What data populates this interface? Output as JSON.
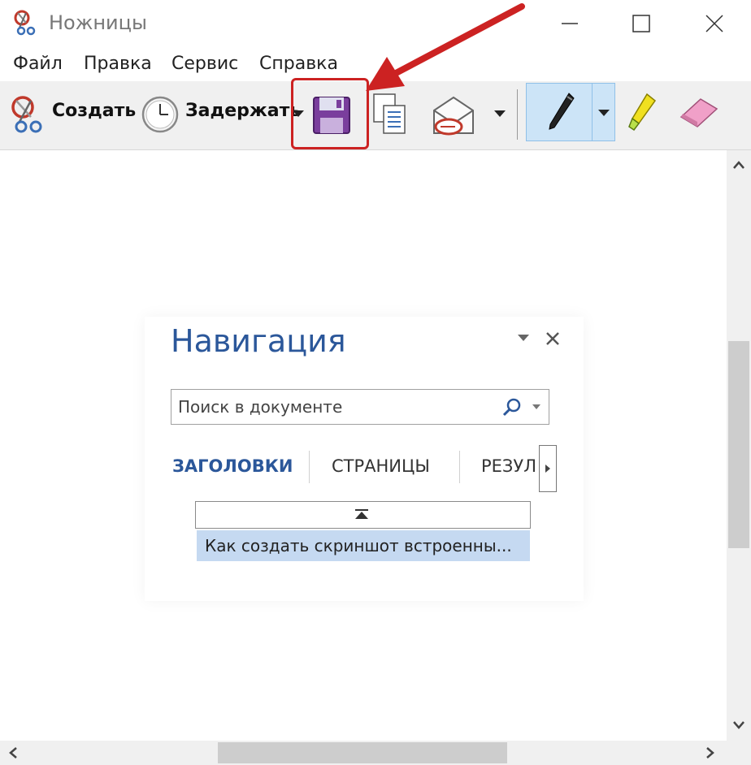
{
  "window": {
    "title": "Ножницы"
  },
  "menu": {
    "items": [
      "Файл",
      "Правка",
      "Сервис",
      "Справка"
    ]
  },
  "toolbar": {
    "new_label": "Создать",
    "delay_label": "Задержать",
    "icons": [
      "scissors-icon",
      "clock-icon",
      "save-icon",
      "copy-icon",
      "email-icon",
      "pen-icon",
      "highlighter-icon",
      "eraser-icon"
    ],
    "accent_color": "#cc2222",
    "pen_selected_color": "#cce4f7"
  },
  "navigation_pane": {
    "title": "Навигация",
    "search_placeholder": "Поиск в документе",
    "tabs": [
      "ЗАГОЛОВКИ",
      "СТРАНИЦЫ",
      "РЕЗУЛ"
    ],
    "active_tab": "ЗАГОЛОВКИ",
    "heading_item": "Как создать скриншот встроенны...",
    "title_color": "#2b579a",
    "highlight_color": "#c5d9f1"
  }
}
